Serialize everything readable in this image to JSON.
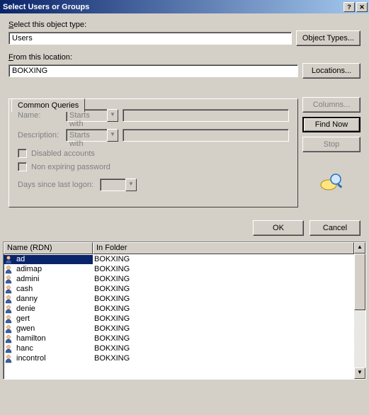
{
  "title": "Select Users or Groups",
  "objectType": {
    "label": "Select this object type:",
    "value": "Users",
    "button": "Object Types..."
  },
  "location": {
    "label": "From this location:",
    "value": "BOKXING",
    "button": "Locations..."
  },
  "tab": "Common Queries",
  "queries": {
    "name": {
      "label": "Name:",
      "mode": "Starts with"
    },
    "description": {
      "label": "Description:",
      "mode": "Starts with"
    },
    "disabled": "Disabled accounts",
    "nonexpire": "Non expiring password",
    "days": "Days since last logon:"
  },
  "buttons": {
    "columns": "Columns...",
    "findNow": "Find Now",
    "stop": "Stop",
    "ok": "OK",
    "cancel": "Cancel"
  },
  "listHeaders": {
    "name": "Name (RDN)",
    "folder": "In Folder"
  },
  "results": [
    {
      "name": "ad",
      "folder": "BOKXING",
      "selected": true
    },
    {
      "name": "adimap",
      "folder": "BOKXING"
    },
    {
      "name": "admini",
      "folder": "BOKXING"
    },
    {
      "name": "cash",
      "folder": "BOKXING"
    },
    {
      "name": "danny",
      "folder": "BOKXING"
    },
    {
      "name": "denie",
      "folder": "BOKXING"
    },
    {
      "name": "gert",
      "folder": "BOKXING"
    },
    {
      "name": "gwen",
      "folder": "BOKXING"
    },
    {
      "name": "hamilton",
      "folder": "BOKXING"
    },
    {
      "name": "hanc",
      "folder": "BOKXING"
    },
    {
      "name": "incontrol",
      "folder": "BOKXING"
    }
  ]
}
